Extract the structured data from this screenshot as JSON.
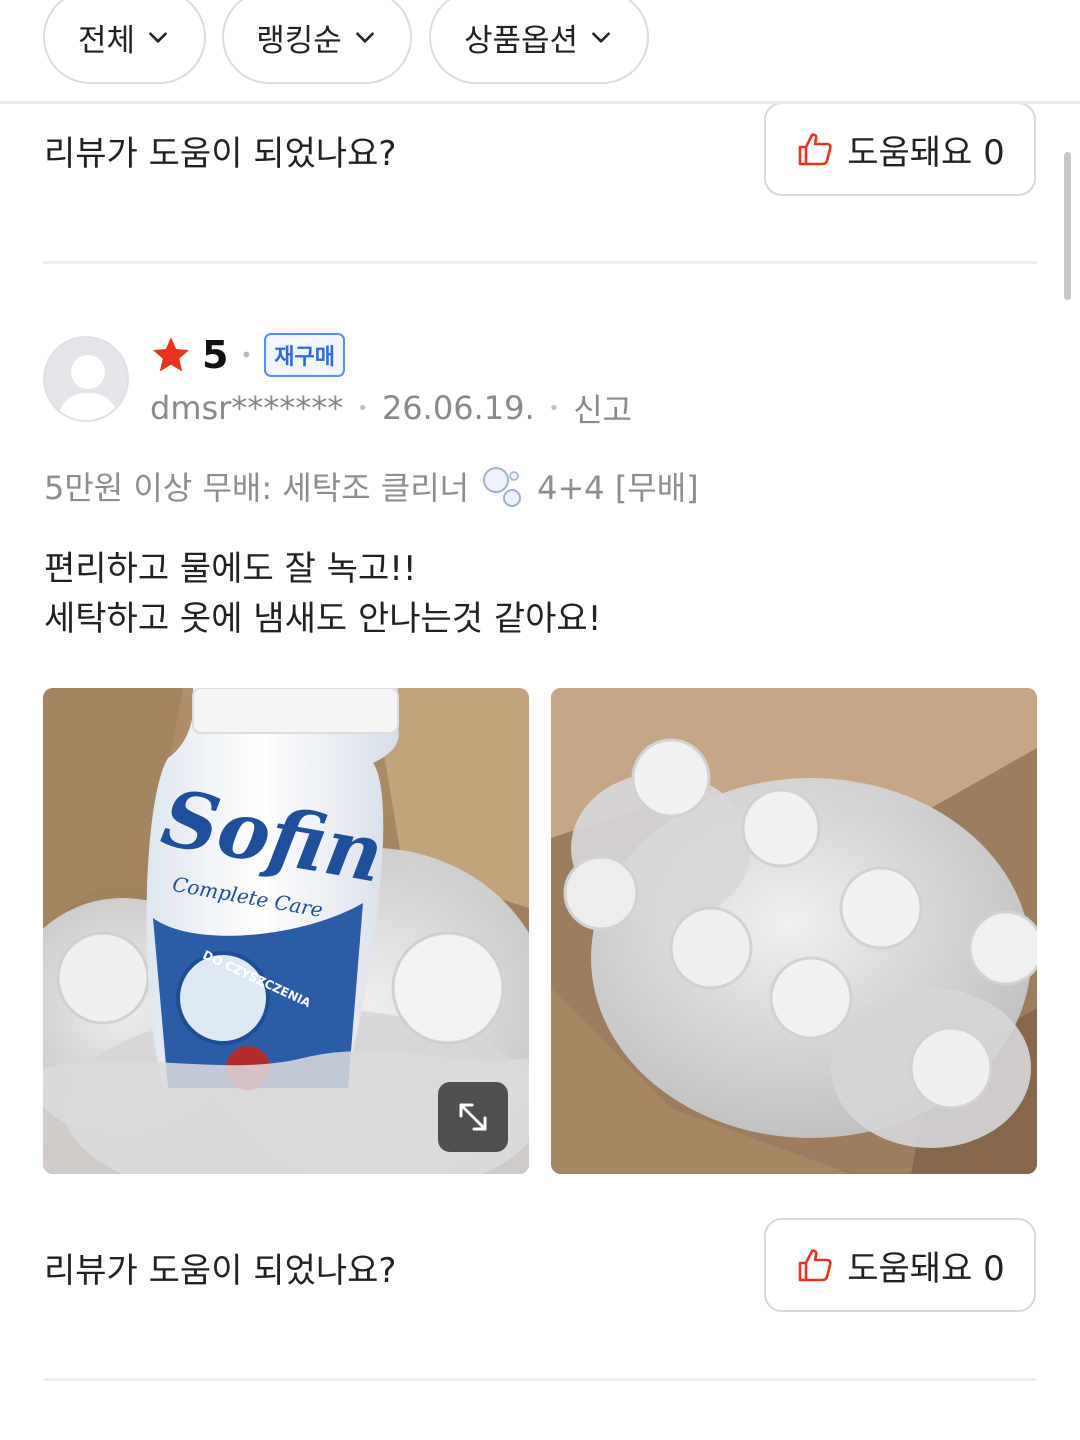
{
  "filters": [
    {
      "label": "전체"
    },
    {
      "label": "랭킹순"
    },
    {
      "label": "상품옵션"
    }
  ],
  "helpful_top": {
    "question": "리뷰가 도움이 되었나요?",
    "button_label": "도움돼요 0"
  },
  "review": {
    "rating": "5",
    "badge": "재구매",
    "user": "dmsr*******",
    "date": "26.06.19.",
    "report": "신고",
    "option_prefix": "5만원 이상 무배: 세탁조 클리너",
    "option_suffix": "4+4 [무배]",
    "text_lines": [
      "편리하고 물에도 잘 녹고!!",
      "세탁하고 옷에 냄새도 안나는것 같아요!"
    ],
    "photo1": {
      "brand": "Sofin",
      "subtitle": "Complete Care",
      "label": "DO CZYSZCZENIA"
    }
  },
  "helpful_bottom": {
    "question": "리뷰가 도움이 되었나요?",
    "button_label": "도움돼요 0"
  },
  "icons": {
    "chevron": "chevron-down-icon",
    "thumb": "thumbs-up-icon",
    "star": "star-icon",
    "expand": "expand-icon",
    "avatar": "avatar-placeholder-icon"
  },
  "colors": {
    "star": "#e8341c",
    "thumb": "#e8341c",
    "badge": "#2d6be0"
  }
}
